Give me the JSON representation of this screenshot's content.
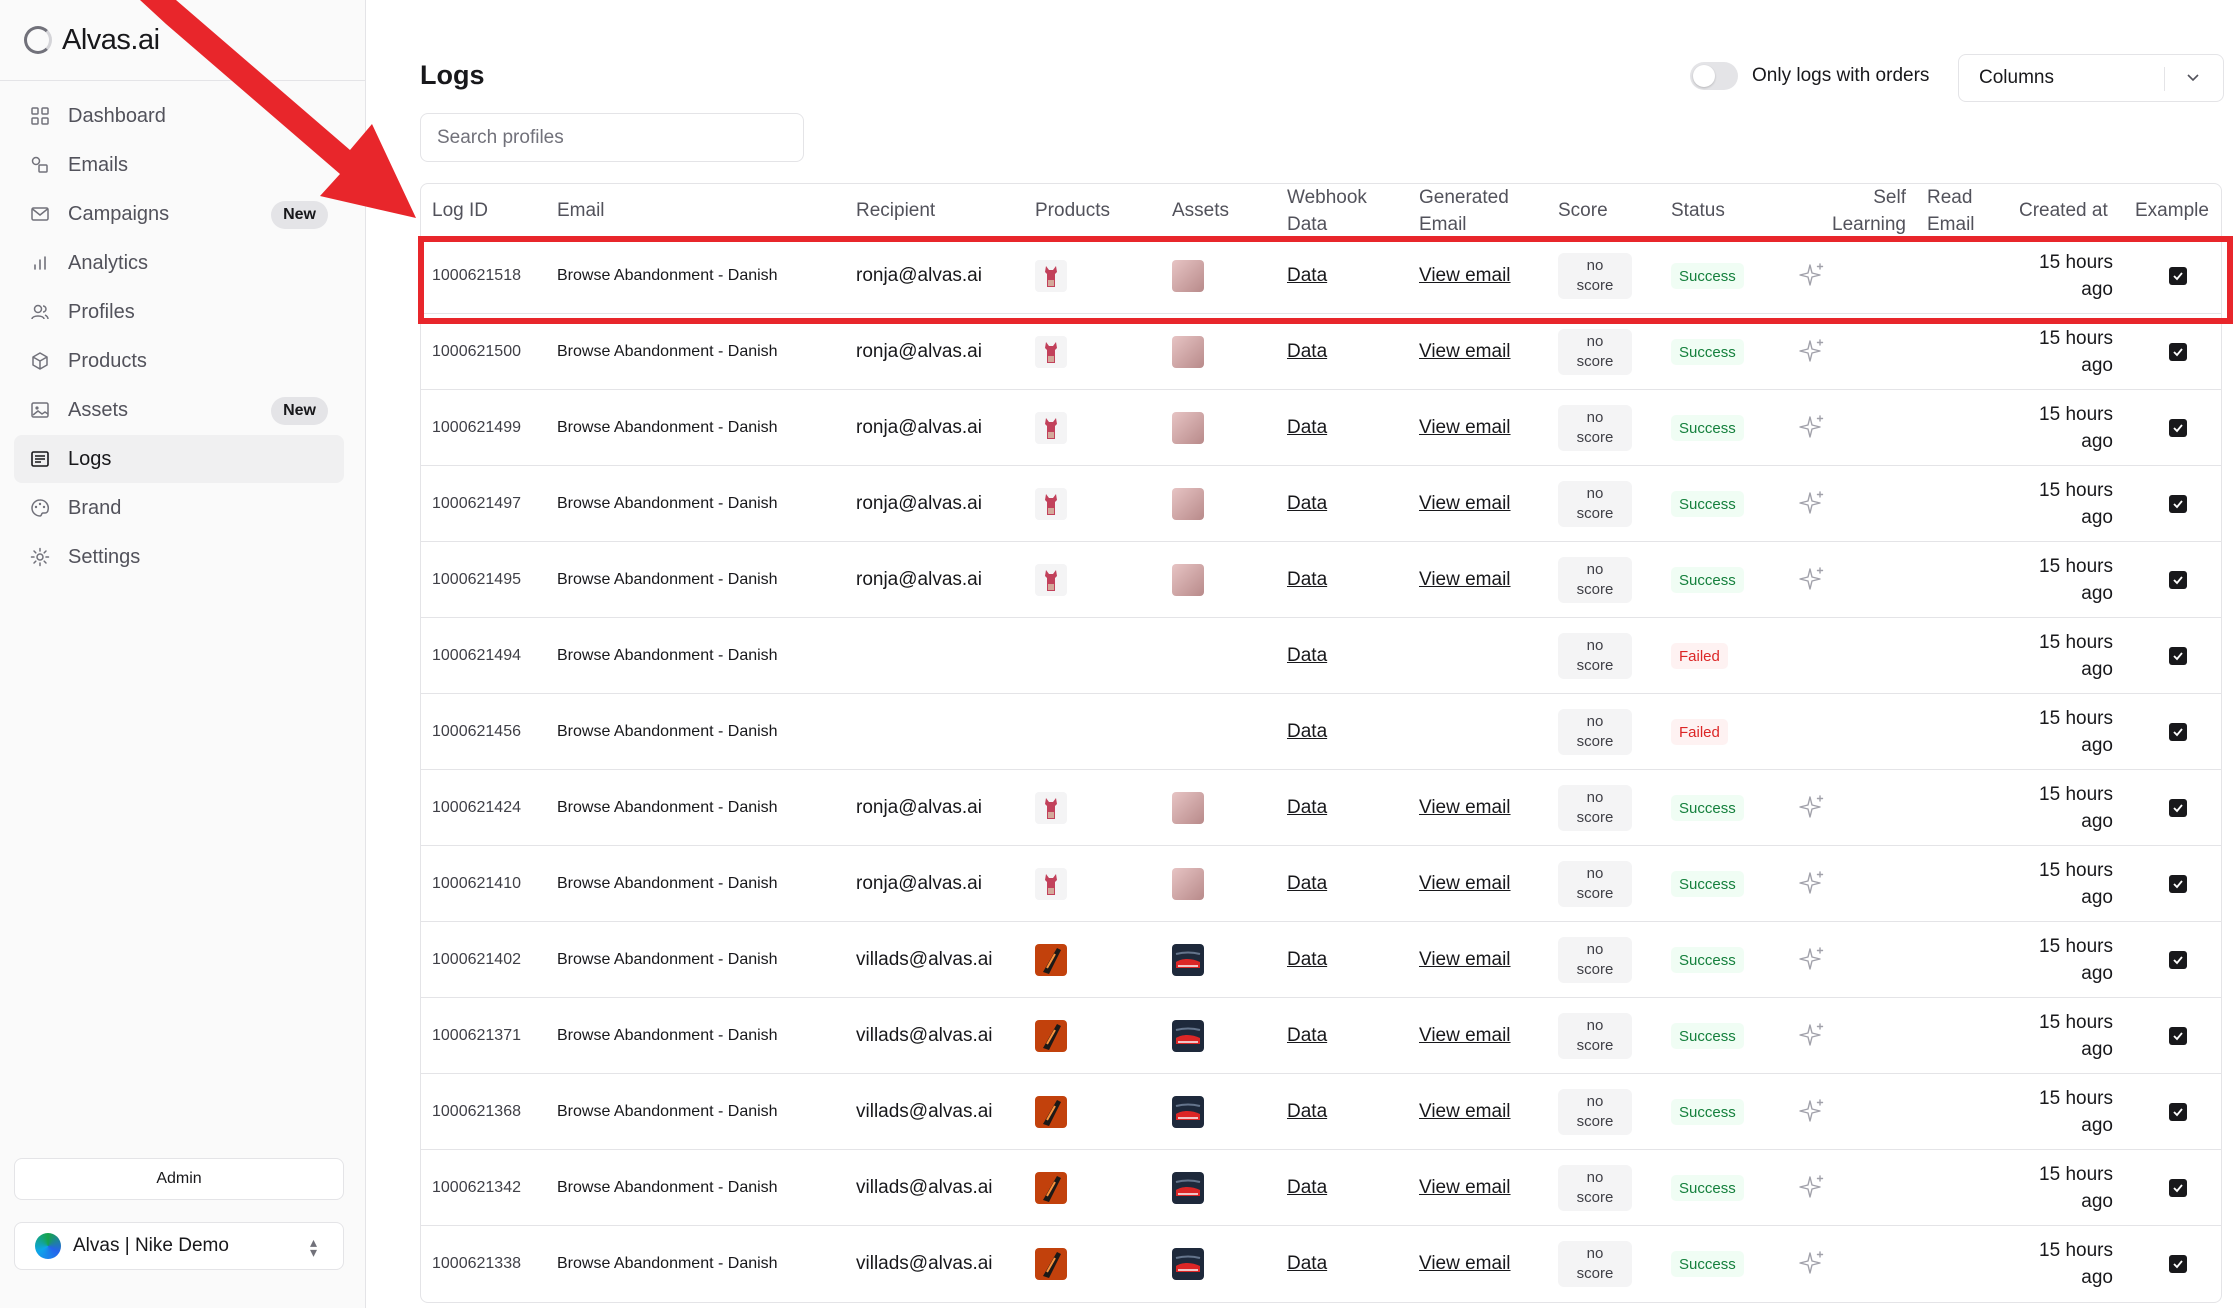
{
  "app": {
    "name": "Alvas.ai"
  },
  "sidebar": {
    "items": [
      {
        "label": "Dashboard",
        "icon": "dashboard-icon",
        "active": false,
        "badge": ""
      },
      {
        "label": "Emails",
        "icon": "emails-icon",
        "active": false,
        "badge": ""
      },
      {
        "label": "Campaigns",
        "icon": "mail-icon",
        "active": false,
        "badge": "New"
      },
      {
        "label": "Analytics",
        "icon": "bar-chart-icon",
        "active": false,
        "badge": ""
      },
      {
        "label": "Profiles",
        "icon": "users-icon",
        "active": false,
        "badge": ""
      },
      {
        "label": "Products",
        "icon": "package-icon",
        "active": false,
        "badge": ""
      },
      {
        "label": "Assets",
        "icon": "image-icon",
        "active": false,
        "badge": "New"
      },
      {
        "label": "Logs",
        "icon": "logs-icon",
        "active": true,
        "badge": ""
      },
      {
        "label": "Brand",
        "icon": "palette-icon",
        "active": false,
        "badge": ""
      },
      {
        "label": "Settings",
        "icon": "gear-icon",
        "active": false,
        "badge": ""
      }
    ],
    "admin_label": "Admin",
    "workspace_label": "Alvas | Nike Demo"
  },
  "page": {
    "title": "Logs",
    "toggle_label": "Only logs with orders",
    "columns_label": "Columns",
    "search_placeholder": "Search profiles"
  },
  "table": {
    "headers": {
      "log_id": "Log ID",
      "email": "Email",
      "recipient": "Recipient",
      "products": "Products",
      "assets": "Assets",
      "webhook_line1": "Webhook",
      "webhook_line2": "Data",
      "generated_line1": "Generated",
      "generated_line2": "Email",
      "score": "Score",
      "status": "Status",
      "self_line1": "Self",
      "self_line2": "Learning",
      "read_line1": "Read",
      "read_line2": "Email",
      "created": "Created at",
      "example": "Example"
    },
    "rows": [
      {
        "id": "1000621518",
        "email": "Browse Abandonment - Danish",
        "recipient": "ronja@alvas.ai",
        "product": "top",
        "asset": "pink",
        "webhook": "Data",
        "view": "View email",
        "score1": "no",
        "score2": "score",
        "status": "Success",
        "created1": "15 hours",
        "created2": "ago"
      },
      {
        "id": "1000621500",
        "email": "Browse Abandonment - Danish",
        "recipient": "ronja@alvas.ai",
        "product": "top",
        "asset": "pink",
        "webhook": "Data",
        "view": "View email",
        "score1": "no",
        "score2": "score",
        "status": "Success",
        "created1": "15 hours",
        "created2": "ago"
      },
      {
        "id": "1000621499",
        "email": "Browse Abandonment - Danish",
        "recipient": "ronja@alvas.ai",
        "product": "top",
        "asset": "pink",
        "webhook": "Data",
        "view": "View email",
        "score1": "no",
        "score2": "score",
        "status": "Success",
        "created1": "15 hours",
        "created2": "ago"
      },
      {
        "id": "1000621497",
        "email": "Browse Abandonment - Danish",
        "recipient": "ronja@alvas.ai",
        "product": "top",
        "asset": "pink",
        "webhook": "Data",
        "view": "View email",
        "score1": "no",
        "score2": "score",
        "status": "Success",
        "created1": "15 hours",
        "created2": "ago"
      },
      {
        "id": "1000621495",
        "email": "Browse Abandonment - Danish",
        "recipient": "ronja@alvas.ai",
        "product": "top",
        "asset": "pink",
        "webhook": "Data",
        "view": "View email",
        "score1": "no",
        "score2": "score",
        "status": "Success",
        "created1": "15 hours",
        "created2": "ago"
      },
      {
        "id": "1000621494",
        "email": "Browse Abandonment - Danish",
        "recipient": "",
        "product": "",
        "asset": "",
        "webhook": "Data",
        "view": "",
        "score1": "no",
        "score2": "score",
        "status": "Failed",
        "created1": "15 hours",
        "created2": "ago"
      },
      {
        "id": "1000621456",
        "email": "Browse Abandonment - Danish",
        "recipient": "",
        "product": "",
        "asset": "",
        "webhook": "Data",
        "view": "",
        "score1": "no",
        "score2": "score",
        "status": "Failed",
        "created1": "15 hours",
        "created2": "ago"
      },
      {
        "id": "1000621424",
        "email": "Browse Abandonment - Danish",
        "recipient": "ronja@alvas.ai",
        "product": "top",
        "asset": "pink",
        "webhook": "Data",
        "view": "View email",
        "score1": "no",
        "score2": "score",
        "status": "Success",
        "created1": "15 hours",
        "created2": "ago"
      },
      {
        "id": "1000621410",
        "email": "Browse Abandonment - Danish",
        "recipient": "ronja@alvas.ai",
        "product": "top",
        "asset": "pink",
        "webhook": "Data",
        "view": "View email",
        "score1": "no",
        "score2": "score",
        "status": "Success",
        "created1": "15 hours",
        "created2": "ago"
      },
      {
        "id": "1000621402",
        "email": "Browse Abandonment - Danish",
        "recipient": "villads@alvas.ai",
        "product": "shoe",
        "asset": "shoe-dark",
        "webhook": "Data",
        "view": "View email",
        "score1": "no",
        "score2": "score",
        "status": "Success",
        "created1": "15 hours",
        "created2": "ago"
      },
      {
        "id": "1000621371",
        "email": "Browse Abandonment - Danish",
        "recipient": "villads@alvas.ai",
        "product": "shoe",
        "asset": "shoe-dark",
        "webhook": "Data",
        "view": "View email",
        "score1": "no",
        "score2": "score",
        "status": "Success",
        "created1": "15 hours",
        "created2": "ago"
      },
      {
        "id": "1000621368",
        "email": "Browse Abandonment - Danish",
        "recipient": "villads@alvas.ai",
        "product": "shoe",
        "asset": "shoe-dark",
        "webhook": "Data",
        "view": "View email",
        "score1": "no",
        "score2": "score",
        "status": "Success",
        "created1": "15 hours",
        "created2": "ago"
      },
      {
        "id": "1000621342",
        "email": "Browse Abandonment - Danish",
        "recipient": "villads@alvas.ai",
        "product": "shoe",
        "asset": "shoe-dark",
        "webhook": "Data",
        "view": "View email",
        "score1": "no",
        "score2": "score",
        "status": "Success",
        "created1": "15 hours",
        "created2": "ago"
      },
      {
        "id": "1000621338",
        "email": "Browse Abandonment - Danish",
        "recipient": "villads@alvas.ai",
        "product": "shoe",
        "asset": "shoe-dark",
        "webhook": "Data",
        "view": "View email",
        "score1": "no",
        "score2": "score",
        "status": "Success",
        "created1": "15 hours",
        "created2": "ago"
      }
    ]
  },
  "colors": {
    "annotation": "#e8262b",
    "success": "#15803d",
    "failed": "#dc2626"
  }
}
